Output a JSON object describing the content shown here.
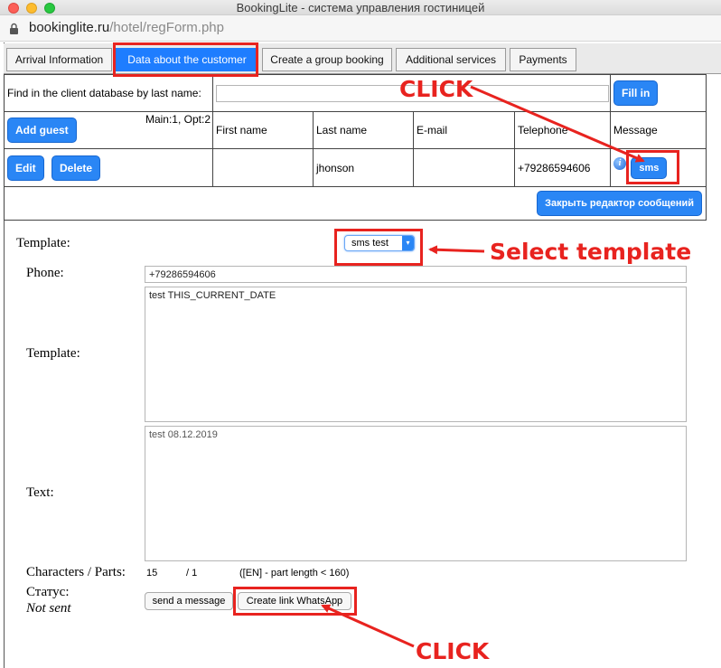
{
  "window": {
    "title": "BookingLite - система управления гостиницей"
  },
  "browser": {
    "url_host": "bookinglite.ru",
    "url_path": "/hotel/regForm.php"
  },
  "tabs": [
    {
      "label": "Arrival Information"
    },
    {
      "label": "Data about the customer"
    },
    {
      "label": "Create a group booking"
    },
    {
      "label": "Additional services"
    },
    {
      "label": "Payments"
    }
  ],
  "search": {
    "label": "Find in the client database by last name:",
    "value": "",
    "fill_label": "Fill in"
  },
  "guests": {
    "add_label": "Add guest",
    "counts": "Main:1, Opt:2",
    "columns": [
      "First name",
      "Last name",
      "E-mail",
      "Telephone",
      "Message"
    ],
    "row": {
      "edit_label": "Edit",
      "delete_label": "Delete",
      "first_name": "",
      "last_name": "jhonson",
      "email": "",
      "telephone": "+79286594606",
      "info_icon": "info-icon",
      "sms_label": "sms"
    },
    "close_editor_label": "Закрыть редактор сообщений"
  },
  "form": {
    "template_label": "Template:",
    "template_selected": "sms test",
    "phone_label": "Phone:",
    "phone_value": "+79286594606",
    "template_text_label": "Template:",
    "template_text": "test THIS_CURRENT_DATE",
    "text_label": "Text:",
    "text_value": "test 08.12.2019",
    "chars_label": "Characters / Parts:",
    "chars": "15",
    "parts": "/ 1",
    "chars_note": "([EN] - part length < 160)",
    "status_label": "Статус:",
    "status_value": "Not sent",
    "send_label": "send a message",
    "whatsapp_label": "Create link WhatsApp"
  },
  "annotations": {
    "click_top": "CLICK",
    "select_template": "Select template",
    "click_bottom": "CLICK",
    "color": "#e8231f"
  }
}
